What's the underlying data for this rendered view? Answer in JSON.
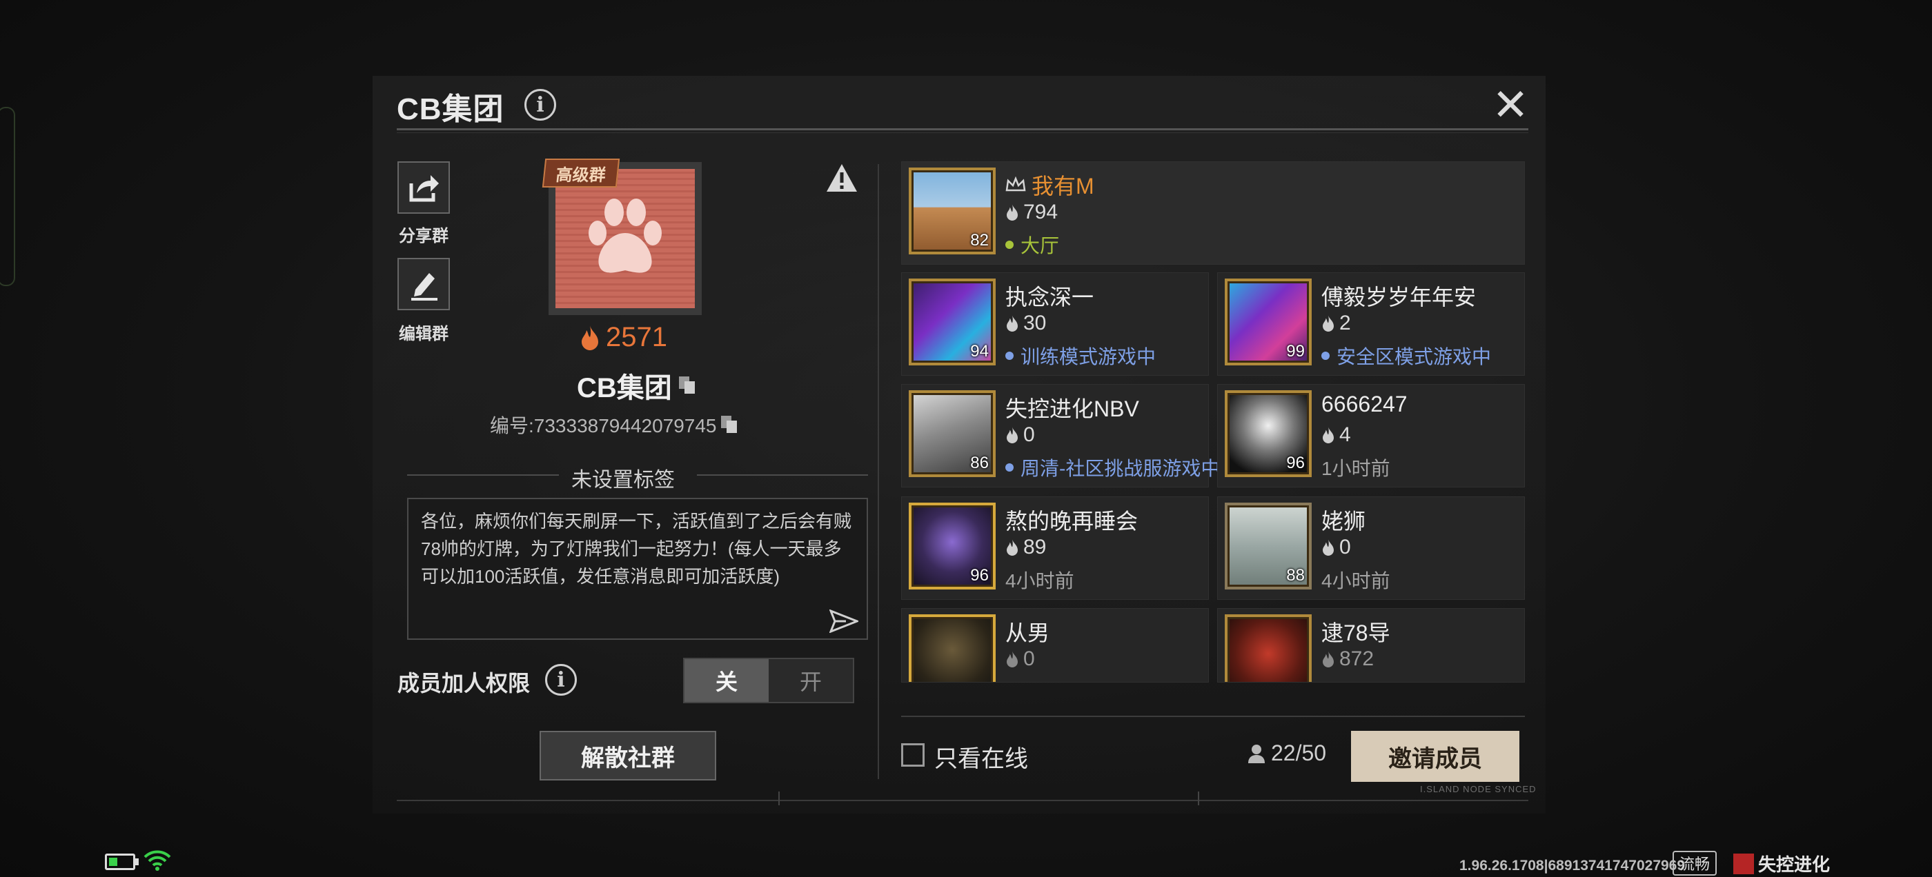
{
  "dialog": {
    "title": "CB集团",
    "share_label": "分享群",
    "edit_label": "编辑群"
  },
  "group": {
    "badge": "高级群",
    "heat": "2571",
    "name": "CB集团",
    "id_text": "编号:73333879442079745",
    "tag": "未设置标签",
    "notice": "各位，麻烦你们每天刷屏一下，活跃值到了之后会有贼78帅的灯牌，为了灯牌我们一起努力！(每人一天最多可以加100活跃值，发任意消息即可加活跃度)",
    "permission_label": "成员加人权限",
    "toggle_off": "关",
    "toggle_on": "开",
    "disband": "解散社群"
  },
  "members": [
    {
      "name": "我有M",
      "heat": "794",
      "status": "大厅",
      "level": "82",
      "owner": true
    },
    {
      "name": "执念深一",
      "heat": "30",
      "status": "训练模式游戏中",
      "level": "94"
    },
    {
      "name": "傅毅岁岁年年安",
      "heat": "2",
      "status": "安全区模式游戏中",
      "level": "99"
    },
    {
      "name": "失控进化NBV",
      "heat": "0",
      "status": "周清-社区挑战服游戏中",
      "level": "86"
    },
    {
      "name": "6666247",
      "heat": "4",
      "status": "1小时前",
      "level": "96"
    },
    {
      "name": "熬的晚再睡会",
      "heat": "89",
      "status": "4小时前",
      "level": "96"
    },
    {
      "name": "姥狮",
      "heat": "0",
      "status": "4小时前",
      "level": "88"
    },
    {
      "name": "从男",
      "heat": "0",
      "status": "",
      "level": ""
    },
    {
      "name": "逮78导",
      "heat": "872",
      "status": "",
      "level": ""
    }
  ],
  "footer": {
    "online_only": "只看在线",
    "count": "22/50",
    "invite": "邀请成员",
    "synced": "I.SLAND NODE SYNCED"
  },
  "statusbar": {
    "version": "1.96.26.1708|68913741747027969",
    "net": "流畅",
    "brand": "失控进化"
  },
  "colors": {
    "accent_orange": "#e8763a",
    "owner_name": "#e79032",
    "status_blue": "#7ea0e6",
    "status_green": "#a8c43a",
    "invite_bg": "#d8cbb7"
  },
  "icons": [
    "share-icon",
    "edit-icon",
    "info-icon",
    "close-icon",
    "warning-icon",
    "flame-icon",
    "copy-icon",
    "send-icon",
    "crown-icon",
    "person-icon",
    "wifi-icon",
    "battery-icon"
  ]
}
